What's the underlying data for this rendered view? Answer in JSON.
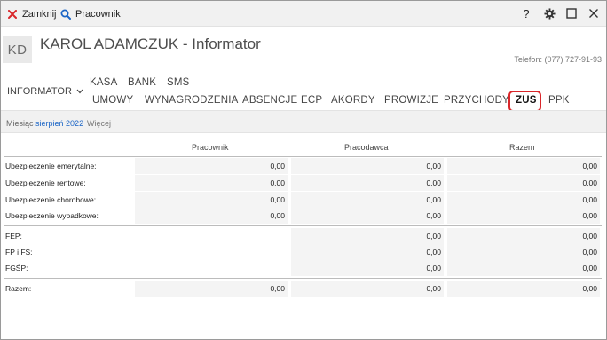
{
  "toolbar": {
    "close_label": "Zamknij",
    "employee_label": "Pracownik"
  },
  "window_controls": {
    "help_label": "?"
  },
  "header": {
    "avatar_initials": "KD",
    "title": "KAROL ADAMCZUK - Informator",
    "phone": "Telefon: (077) 727-91-93"
  },
  "nav": {
    "dropdown_label": "INFORMATOR",
    "top_row": [
      "KASA",
      "BANK",
      "SMS"
    ],
    "bottom_row": [
      "UMOWY",
      "WYNAGRODZENIA",
      "ABSENCJE",
      "ECP",
      "AKORDY",
      "PROWIZJE",
      "PRZYCHODY",
      "ZUS",
      "PPK"
    ],
    "active": "ZUS"
  },
  "filter": {
    "month_label": "Miesiąc",
    "month_value": "sierpień 2022",
    "more_label": "Więcej"
  },
  "table": {
    "columns": [
      "Pracownik",
      "Pracodawca",
      "Razem"
    ],
    "rows": [
      {
        "label": "Ubezpieczenie emerytalne:",
        "values": [
          "0,00",
          "0,00",
          "0,00"
        ]
      },
      {
        "label": "Ubezpieczenie rentowe:",
        "values": [
          "0,00",
          "0,00",
          "0,00"
        ]
      },
      {
        "label": "Ubezpieczenie chorobowe:",
        "values": [
          "0,00",
          "0,00",
          "0,00"
        ]
      },
      {
        "label": "Ubezpieczenie wypadkowe:",
        "values": [
          "0,00",
          "0,00",
          "0,00"
        ]
      },
      {
        "label": "FEP:",
        "values": [
          "",
          "0,00",
          "0,00"
        ]
      },
      {
        "label": "FP i FS:",
        "values": [
          "",
          "0,00",
          "0,00"
        ]
      },
      {
        "label": "FGŚP:",
        "values": [
          "",
          "0,00",
          "0,00"
        ]
      },
      {
        "label": "Razem:",
        "values": [
          "0,00",
          "0,00",
          "0,00"
        ]
      }
    ]
  },
  "colors": {
    "accent_link": "#1a64c6",
    "close_icon": "#d9262a",
    "highlight_box": "#d9262a"
  }
}
